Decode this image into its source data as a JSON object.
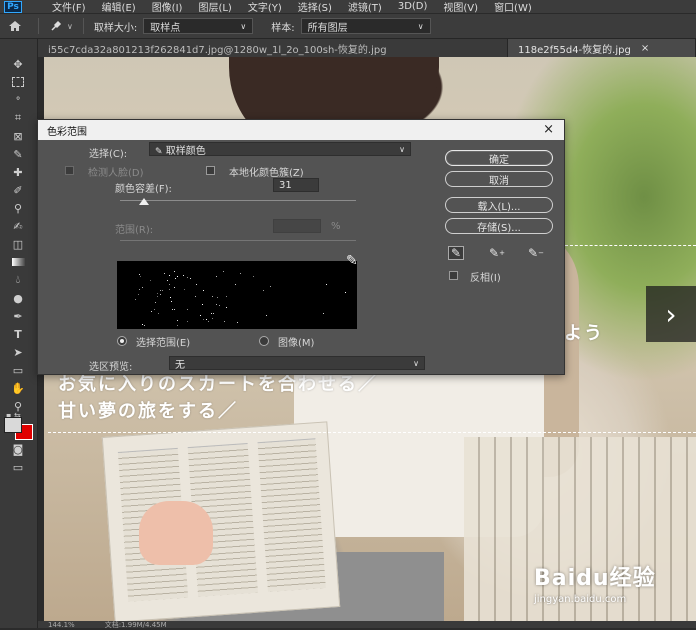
{
  "app": {
    "logo": "Ps"
  },
  "menu": [
    "文件(F)",
    "编辑(E)",
    "图像(I)",
    "图层(L)",
    "文字(Y)",
    "选择(S)",
    "滤镜(T)",
    "3D(D)",
    "视图(V)",
    "窗口(W)"
  ],
  "options_bar": {
    "home_icon": "home-icon",
    "tool_icon": "eyedropper-icon",
    "sample_size_label": "取样大小:",
    "sample_size_value": "取样点",
    "sample_label": "样本:",
    "sample_value": "所有图层"
  },
  "tabs": [
    {
      "label": "i55c7cda32a801213f262841d7.jpg@1280w_1l_2o_100sh-恢复的.jpg",
      "active": false
    },
    {
      "label": "118e2f55d4-恢复的.jpg",
      "active": true,
      "close": "×"
    }
  ],
  "canvas_text": {
    "line1": "よう",
    "line2": "お気に入りのスカートを合わせる／",
    "line3": "甘い夢の旅をする／"
  },
  "watermark": {
    "brand": "Baidu经验",
    "url": "jingyan.baidu.com"
  },
  "status": {
    "zoom": "144.1%",
    "doc": "文档:1.99M/4.45M"
  },
  "dialog": {
    "title": "色彩范围",
    "close": "×",
    "select_label": "选择(C):",
    "select_value": "取样颜色",
    "detect_faces": "检测人脸(D)",
    "localized": "本地化颜色簇(Z)",
    "fuzziness_label": "颜色容差(F):",
    "fuzziness_value": "31",
    "fuzziness_fraction": 0.1,
    "range_label": "范围(R):",
    "range_unit": "%",
    "mode_selection": "选择范围(E)",
    "mode_image": "图像(M)",
    "preview_label": "选区预览:",
    "preview_value": "无",
    "buttons": {
      "ok": "确定",
      "cancel": "取消",
      "load": "载入(L)...",
      "save": "存储(S)..."
    },
    "invert": "反相(I)",
    "eyedroppers": [
      "eyedropper-icon",
      "eyedropper-plus-icon",
      "eyedropper-minus-icon"
    ]
  },
  "colors": {
    "foreground": "#d9d9d9",
    "background": "#e00000"
  }
}
